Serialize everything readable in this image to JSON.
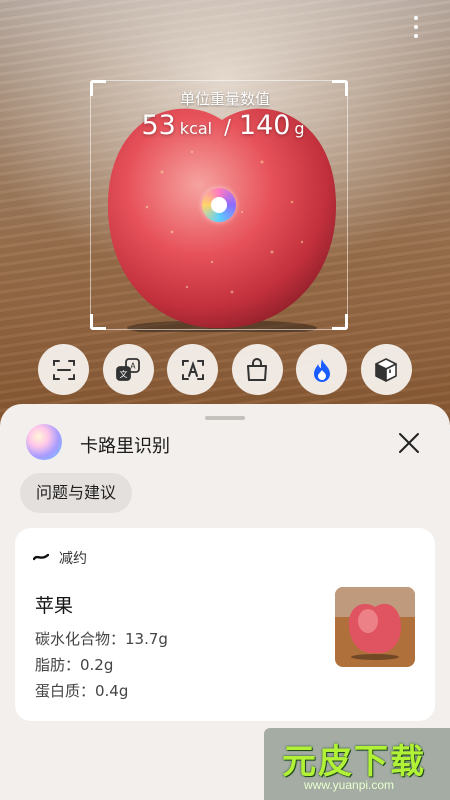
{
  "camera": {
    "unit_label": "单位重量数值",
    "kcal_value": "53",
    "kcal_unit": "kcal",
    "separator": "/",
    "weight_value": "140",
    "weight_unit": "g"
  },
  "tools": [
    {
      "icon": "scan-icon"
    },
    {
      "icon": "translate-icon"
    },
    {
      "icon": "text-recognition-icon"
    },
    {
      "icon": "shopping-bag-icon"
    },
    {
      "icon": "flame-icon",
      "accent": "#1a5cff"
    },
    {
      "icon": "box-icon"
    }
  ],
  "sheet": {
    "title": "卡路里识别",
    "chip_label": "问题与建议",
    "card": {
      "brand": "减约",
      "food_name": "苹果",
      "carbs": "碳水化合物：13.7g",
      "fat": "脂肪：0.2g",
      "protein": "蛋白质：0.4g"
    }
  },
  "watermark": {
    "main": "元皮下载",
    "sub": "www.yuanpi.com"
  }
}
